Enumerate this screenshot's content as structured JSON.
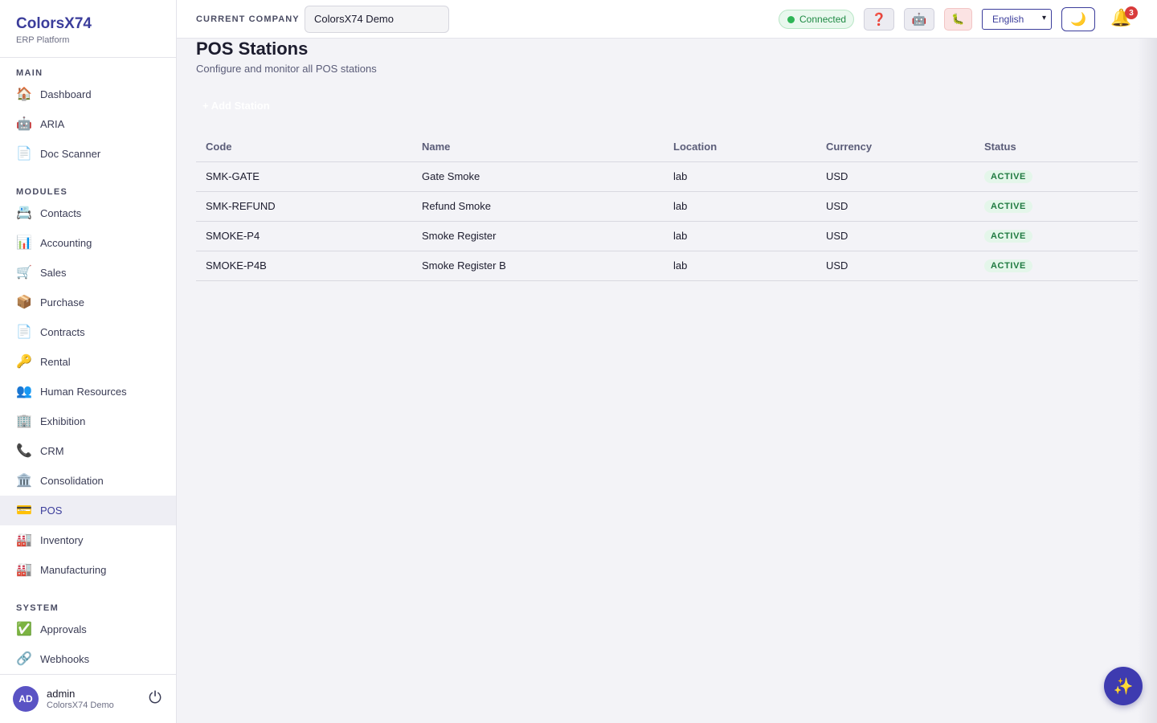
{
  "brand": {
    "title": "ColorsX74",
    "subtitle": "ERP Platform"
  },
  "sidebar": {
    "sections": [
      {
        "label": "MAIN",
        "items": [
          {
            "label": "Dashboard",
            "icon": "🏠"
          },
          {
            "label": "ARIA",
            "icon": "🤖"
          },
          {
            "label": "Doc Scanner",
            "icon": "📄"
          }
        ]
      },
      {
        "label": "MODULES",
        "items": [
          {
            "label": "Contacts",
            "icon": "📇"
          },
          {
            "label": "Accounting",
            "icon": "📊"
          },
          {
            "label": "Sales",
            "icon": "🛒"
          },
          {
            "label": "Purchase",
            "icon": "📦"
          },
          {
            "label": "Contracts",
            "icon": "📄"
          },
          {
            "label": "Rental",
            "icon": "🔑"
          },
          {
            "label": "Human Resources",
            "icon": "👥"
          },
          {
            "label": "Exhibition",
            "icon": "🏢"
          },
          {
            "label": "CRM",
            "icon": "📞"
          },
          {
            "label": "Consolidation",
            "icon": "🏛️"
          },
          {
            "label": "POS",
            "icon": "💳",
            "active": true
          },
          {
            "label": "Inventory",
            "icon": "🏭"
          },
          {
            "label": "Manufacturing",
            "icon": "🏭"
          }
        ]
      },
      {
        "label": "SYSTEM",
        "items": [
          {
            "label": "Approvals",
            "icon": "✅"
          },
          {
            "label": "Webhooks",
            "icon": "🔗"
          }
        ]
      }
    ],
    "active_color": "#3b3d9b"
  },
  "user": {
    "initials": "AD",
    "name": "admin",
    "company": "ColorsX74 Demo"
  },
  "topbar": {
    "company_label": "CURRENT COMPANY",
    "company_value": "ColorsX74 Demo",
    "connection_status": "Connected",
    "language": "English",
    "help_icon": "❓",
    "robot_icon": "🤖",
    "bug_icon": "🐛",
    "theme_icon": "🌙",
    "bell_icon": "🔔",
    "notification_count": "3",
    "logout_icon": "⏻"
  },
  "page": {
    "title": "POS Stations",
    "subtitle": "Configure and monitor all POS stations",
    "add_button": "+ Add Station"
  },
  "table": {
    "columns": [
      "Code",
      "Name",
      "Location",
      "Currency",
      "Status"
    ],
    "rows": [
      {
        "code": "SMK-GATE",
        "name": "Gate Smoke",
        "location": "lab",
        "currency": "USD",
        "status": "ACTIVE"
      },
      {
        "code": "SMK-REFUND",
        "name": "Refund Smoke",
        "location": "lab",
        "currency": "USD",
        "status": "ACTIVE"
      },
      {
        "code": "SMOKE-P4",
        "name": "Smoke Register",
        "location": "lab",
        "currency": "USD",
        "status": "ACTIVE"
      },
      {
        "code": "SMOKE-P4B",
        "name": "Smoke Register B",
        "location": "lab",
        "currency": "USD",
        "status": "ACTIVE"
      }
    ]
  },
  "fab_icon": "✨"
}
